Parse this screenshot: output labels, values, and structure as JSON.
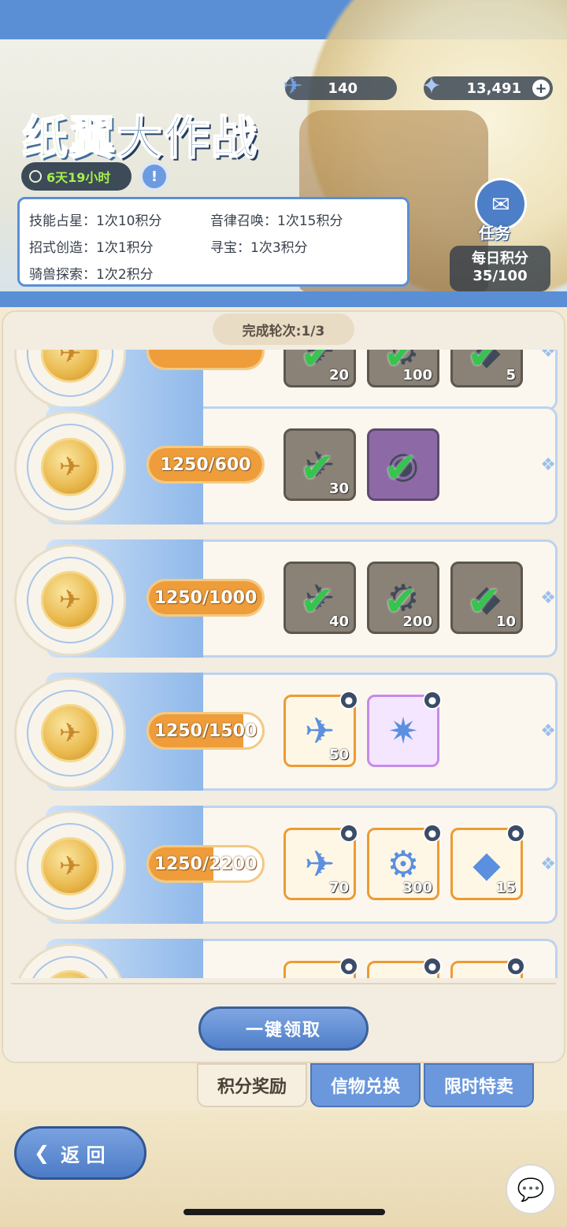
{
  "header": {
    "title_part1": "纸翼",
    "title_part2": "大作战",
    "timer": "6天19小时",
    "info_glyph": "!",
    "resources": [
      {
        "icon": "paper-plane-icon",
        "glyph": "✈",
        "value": "140"
      },
      {
        "icon": "star-crystal-icon",
        "glyph": "✦",
        "value": "13,491",
        "plus": "+"
      }
    ],
    "rules": [
      [
        "技能占星：1次10积分",
        "音律召唤：1次15积分"
      ],
      [
        "招式创造：1次1积分",
        "寻宝：1次3积分"
      ],
      [
        "骑兽探索：1次2积分",
        ""
      ]
    ],
    "task_label": "任务",
    "task_glyph": "✉",
    "daily_label": "每日积分",
    "daily_value": "35/100"
  },
  "rounds_label": "完成轮次:1/3",
  "tiers": [
    {
      "progress_text": "",
      "progress_pct": 100,
      "items": [
        {
          "glyph": "✈",
          "qty": "20",
          "state": "claimed",
          "style": ""
        },
        {
          "glyph": "⚙",
          "qty": "100",
          "state": "claimed",
          "style": ""
        },
        {
          "glyph": "◆",
          "qty": "5",
          "state": "claimed",
          "style": ""
        }
      ]
    },
    {
      "progress_text": "1250/600",
      "progress_pct": 100,
      "items": [
        {
          "glyph": "✈",
          "qty": "30",
          "state": "claimed",
          "style": ""
        },
        {
          "glyph": "◉",
          "qty": "",
          "state": "claimed",
          "style": "purple"
        }
      ]
    },
    {
      "progress_text": "1250/1000",
      "progress_pct": 100,
      "items": [
        {
          "glyph": "✈",
          "qty": "40",
          "state": "claimed",
          "style": ""
        },
        {
          "glyph": "⚙",
          "qty": "200",
          "state": "claimed",
          "style": ""
        },
        {
          "glyph": "◆",
          "qty": "10",
          "state": "claimed",
          "style": ""
        }
      ]
    },
    {
      "progress_text": "1250/1500",
      "progress_pct": 83,
      "items": [
        {
          "glyph": "✈",
          "qty": "50",
          "state": "open",
          "style": ""
        },
        {
          "glyph": "✷",
          "qty": "",
          "state": "open",
          "style": "purple"
        }
      ]
    },
    {
      "progress_text": "1250/2200",
      "progress_pct": 57,
      "items": [
        {
          "glyph": "✈",
          "qty": "70",
          "state": "open",
          "style": ""
        },
        {
          "glyph": "⚙",
          "qty": "300",
          "state": "open",
          "style": ""
        },
        {
          "glyph": "◆",
          "qty": "15",
          "state": "open",
          "style": ""
        }
      ]
    },
    {
      "progress_text": "",
      "progress_pct": 0,
      "items": [
        {
          "glyph": "✈",
          "qty": "",
          "state": "open",
          "style": ""
        },
        {
          "glyph": "⚙",
          "qty": "",
          "state": "open",
          "style": ""
        },
        {
          "glyph": "◆",
          "qty": "",
          "state": "open",
          "style": ""
        }
      ]
    }
  ],
  "claim_all_label": "一键领取",
  "tabs": [
    {
      "label": "积分奖励",
      "active": true
    },
    {
      "label": "信物兑换",
      "active": false
    },
    {
      "label": "限时特卖",
      "active": false
    }
  ],
  "back_label": "返 回",
  "back_glyph": "❮",
  "chat_glyph": "💬",
  "colors": {
    "accent_blue": "#5a8fd6",
    "progress_orange": "#ee9d3a",
    "check_green": "#36c44e"
  }
}
